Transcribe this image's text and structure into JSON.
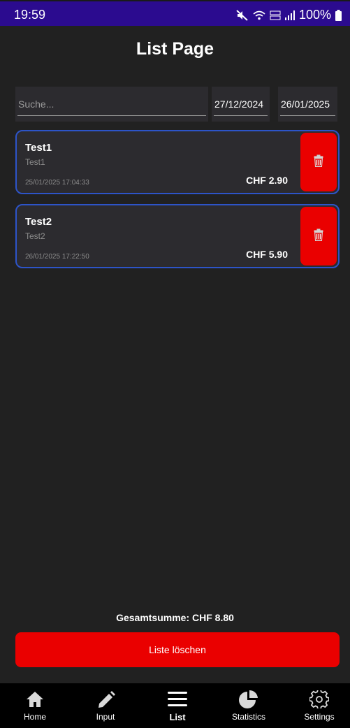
{
  "status_bar": {
    "time": "19:59",
    "battery": "100%",
    "icons": [
      "mute-icon",
      "wifi-icon",
      "volte-icon",
      "signal-icon",
      "battery-icon"
    ]
  },
  "header": {
    "title": "List Page"
  },
  "filters": {
    "search_placeholder": "Suche...",
    "date_from": "27/12/2024",
    "date_to": "26/01/2025"
  },
  "items": [
    {
      "title": "Test1",
      "subtitle": "Test1",
      "datetime": "25/01/2025 17:04:33",
      "amount": "CHF 2.90"
    },
    {
      "title": "Test2",
      "subtitle": "Test2",
      "datetime": "26/01/2025 17:22:50",
      "amount": "CHF 5.90"
    }
  ],
  "summary": {
    "total": "Gesamtsumme: CHF 8.80",
    "clear_label": "Liste löschen"
  },
  "nav": {
    "items": [
      {
        "label": "Home",
        "icon": "home-icon"
      },
      {
        "label": "Input",
        "icon": "pencil-icon"
      },
      {
        "label": "List",
        "icon": "list-icon",
        "active": true
      },
      {
        "label": "Statistics",
        "icon": "pie-chart-icon"
      },
      {
        "label": "Settings",
        "icon": "gear-icon"
      }
    ]
  },
  "colors": {
    "status_bar": "#2b0b8f",
    "background": "#212121",
    "card": "#2c2b2f",
    "card_border": "#2d54c8",
    "danger": "#ea0000",
    "nav_background": "#000000"
  }
}
